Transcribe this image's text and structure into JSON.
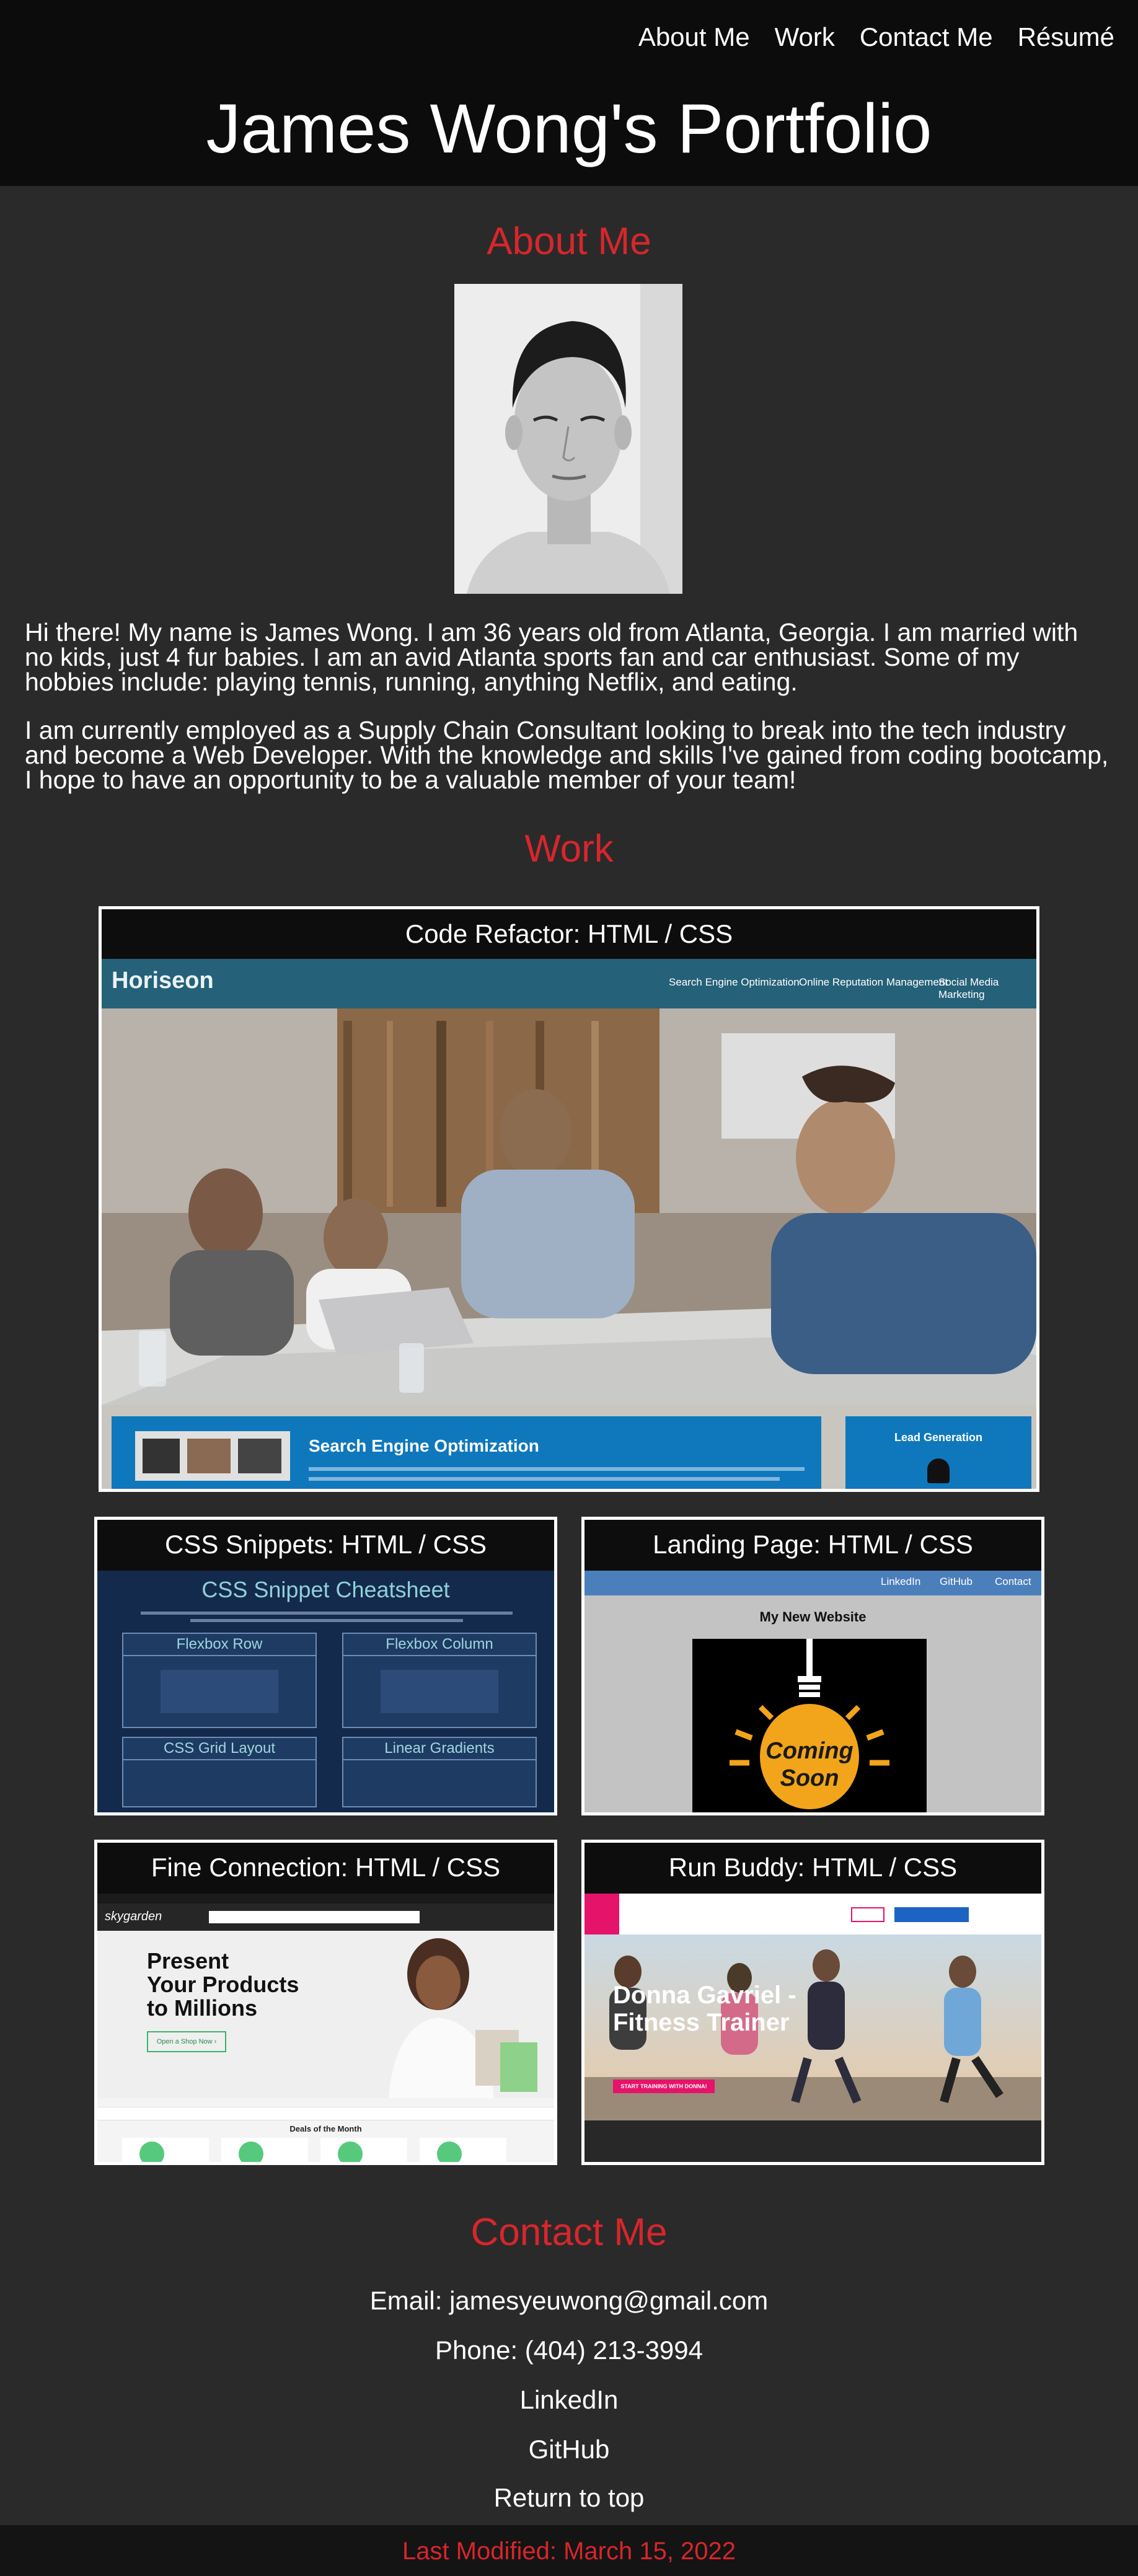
{
  "nav": {
    "about": "About Me",
    "work": "Work",
    "contact": "Contact Me",
    "resume": "Résumé"
  },
  "site_title": "James Wong's Portfolio",
  "about": {
    "heading": "About Me",
    "paragraph_1": "Hi there! My name is James Wong. I am 36 years old from Atlanta, Georgia. I am married with no kids, just 4 fur babies. I am an avid Atlanta sports fan and car enthusiast. Some of my hobbies include: playing tennis, running, anything Netflix, and eating.",
    "paragraph_2": "I am currently employed as a Supply Chain Consultant looking to break into the tech industry and become a Web Developer. With the knowledge and skills I've gained from coding bootcamp, I hope to have an opportunity to be a valuable member of your team!"
  },
  "work": {
    "heading": "Work",
    "projects": [
      {
        "title": "Code Refactor: HTML / CSS",
        "preview": {
          "brand": "Horiseon",
          "nav": [
            "Search Engine Optimization",
            "Online Reputation Management",
            "Social Media Marketing"
          ],
          "section": "Search Engine Optimization",
          "side": "Lead Generation"
        }
      },
      {
        "title": "CSS Snippets: HTML / CSS",
        "preview": {
          "heading": "CSS Snippet Cheatsheet",
          "boxes": [
            "Flexbox Row",
            "Flexbox Column",
            "CSS Grid Layout",
            "Linear Gradients"
          ]
        }
      },
      {
        "title": "Landing Page: HTML / CSS",
        "preview": {
          "nav": [
            "LinkedIn",
            "GitHub",
            "Contact"
          ],
          "heading": "My New Website",
          "sign_line_1": "Coming",
          "sign_line_2": "Soon"
        }
      },
      {
        "title": "Fine Connection: HTML / CSS",
        "preview": {
          "brand": "skygarden",
          "headline_1": "Present",
          "headline_2": "Your Products",
          "headline_3": "to Millions",
          "button": "Open a Shop Now ›",
          "deals": "Deals of the Month"
        }
      },
      {
        "title": "Run Buddy: HTML / CSS",
        "preview": {
          "hero_line_1": "Donna Gavriel -",
          "hero_line_2": "Fitness Trainer",
          "button": "START TRAINING WITH DONNA!"
        }
      }
    ]
  },
  "contact": {
    "heading": "Contact Me",
    "email": "Email: jamesyeuwong@gmail.com",
    "phone": "Phone: (404) 213-3994",
    "linkedin": "LinkedIn",
    "github": "GitHub",
    "top": "Return to top"
  },
  "footer": {
    "last_modified": "Last Modified: March 15, 2022"
  },
  "colors": {
    "accent": "#d7262c",
    "header_bg": "#0c0c0c",
    "page_bg": "#2a2a2a"
  }
}
